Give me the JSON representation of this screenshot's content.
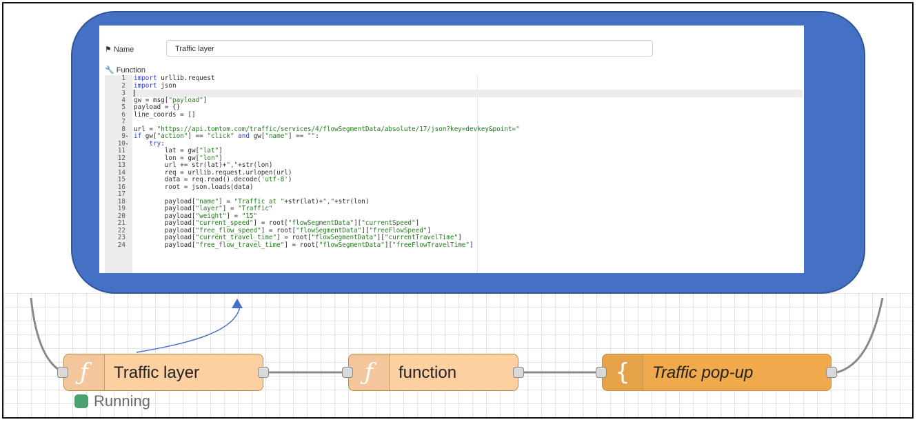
{
  "editor_panel": {
    "name_label": "Name",
    "name_value": "Traffic layer",
    "function_label": "Function",
    "code_lines": [
      {
        "n": "1",
        "fold": "",
        "active": false,
        "tokens": [
          {
            "t": "import",
            "c": "kw"
          },
          {
            "t": " urllib.request",
            "c": ""
          }
        ]
      },
      {
        "n": "2",
        "fold": "",
        "active": false,
        "tokens": [
          {
            "t": "import",
            "c": "kw"
          },
          {
            "t": " json",
            "c": ""
          }
        ]
      },
      {
        "n": "3",
        "fold": "",
        "active": true,
        "tokens": [],
        "cursor": true
      },
      {
        "n": "4",
        "fold": "",
        "active": false,
        "tokens": [
          {
            "t": "gw = msg[",
            "c": ""
          },
          {
            "t": "\"payload\"",
            "c": "str"
          },
          {
            "t": "]",
            "c": ""
          }
        ]
      },
      {
        "n": "5",
        "fold": "",
        "active": false,
        "tokens": [
          {
            "t": "payload = {}",
            "c": ""
          }
        ]
      },
      {
        "n": "6",
        "fold": "",
        "active": false,
        "tokens": [
          {
            "t": "line_coords = []",
            "c": ""
          }
        ]
      },
      {
        "n": "7",
        "fold": "",
        "active": false,
        "tokens": []
      },
      {
        "n": "8",
        "fold": "",
        "active": false,
        "tokens": [
          {
            "t": "url = ",
            "c": ""
          },
          {
            "t": "\"https://api.tomtom.com/traffic/services/4/flowSegmentData/absolute/17/json?key=devkey&point=\"",
            "c": "str"
          }
        ]
      },
      {
        "n": "9",
        "fold": "▾",
        "active": false,
        "tokens": [
          {
            "t": "if",
            "c": "kw"
          },
          {
            "t": " gw[",
            "c": ""
          },
          {
            "t": "\"action\"",
            "c": "str"
          },
          {
            "t": "] == ",
            "c": ""
          },
          {
            "t": "\"click\"",
            "c": "str"
          },
          {
            "t": " ",
            "c": ""
          },
          {
            "t": "and",
            "c": "kw"
          },
          {
            "t": " gw[",
            "c": ""
          },
          {
            "t": "\"name\"",
            "c": "str"
          },
          {
            "t": "] == ",
            "c": ""
          },
          {
            "t": "\"\"",
            "c": "str"
          },
          {
            "t": ":",
            "c": ""
          }
        ]
      },
      {
        "n": "10",
        "fold": "▾",
        "active": false,
        "tokens": [
          {
            "t": "    ",
            "c": ""
          },
          {
            "t": "try",
            "c": "kw"
          },
          {
            "t": ":",
            "c": ""
          }
        ]
      },
      {
        "n": "11",
        "fold": "",
        "active": false,
        "tokens": [
          {
            "t": "        lat = gw[",
            "c": ""
          },
          {
            "t": "\"lat\"",
            "c": "str"
          },
          {
            "t": "]",
            "c": ""
          }
        ]
      },
      {
        "n": "12",
        "fold": "",
        "active": false,
        "tokens": [
          {
            "t": "        lon = gw[",
            "c": ""
          },
          {
            "t": "\"lon\"",
            "c": "str"
          },
          {
            "t": "]",
            "c": ""
          }
        ]
      },
      {
        "n": "13",
        "fold": "",
        "active": false,
        "tokens": [
          {
            "t": "        url += str(lat)+",
            "c": ""
          },
          {
            "t": "\",\"",
            "c": "str"
          },
          {
            "t": "+str(lon)",
            "c": ""
          }
        ]
      },
      {
        "n": "14",
        "fold": "",
        "active": false,
        "tokens": [
          {
            "t": "        req = urllib.request.urlopen(url)",
            "c": ""
          }
        ]
      },
      {
        "n": "15",
        "fold": "",
        "active": false,
        "tokens": [
          {
            "t": "        data = req.read().decode(",
            "c": ""
          },
          {
            "t": "'utf-8'",
            "c": "str"
          },
          {
            "t": ")",
            "c": ""
          }
        ]
      },
      {
        "n": "16",
        "fold": "",
        "active": false,
        "tokens": [
          {
            "t": "        root = json.loads(data)",
            "c": ""
          }
        ]
      },
      {
        "n": "17",
        "fold": "",
        "active": false,
        "tokens": []
      },
      {
        "n": "18",
        "fold": "",
        "active": false,
        "tokens": [
          {
            "t": "        payload[",
            "c": ""
          },
          {
            "t": "\"name\"",
            "c": "str"
          },
          {
            "t": "] = ",
            "c": ""
          },
          {
            "t": "\"Traffic at \"",
            "c": "str"
          },
          {
            "t": "+str(lat)+",
            "c": ""
          },
          {
            "t": "\",\"",
            "c": "str"
          },
          {
            "t": "+str(lon)",
            "c": ""
          }
        ]
      },
      {
        "n": "19",
        "fold": "",
        "active": false,
        "tokens": [
          {
            "t": "        payload[",
            "c": ""
          },
          {
            "t": "\"layer\"",
            "c": "str"
          },
          {
            "t": "] = ",
            "c": ""
          },
          {
            "t": "\"Traffic\"",
            "c": "str"
          }
        ]
      },
      {
        "n": "20",
        "fold": "",
        "active": false,
        "tokens": [
          {
            "t": "        payload[",
            "c": ""
          },
          {
            "t": "\"weight\"",
            "c": "str"
          },
          {
            "t": "] = ",
            "c": ""
          },
          {
            "t": "\"15\"",
            "c": "str"
          }
        ]
      },
      {
        "n": "21",
        "fold": "",
        "active": false,
        "tokens": [
          {
            "t": "        payload[",
            "c": ""
          },
          {
            "t": "\"current_speed\"",
            "c": "str"
          },
          {
            "t": "] = root[",
            "c": ""
          },
          {
            "t": "\"flowSegmentData\"",
            "c": "str"
          },
          {
            "t": "][",
            "c": ""
          },
          {
            "t": "\"currentSpeed\"",
            "c": "str"
          },
          {
            "t": "]",
            "c": ""
          }
        ]
      },
      {
        "n": "22",
        "fold": "",
        "active": false,
        "tokens": [
          {
            "t": "        payload[",
            "c": ""
          },
          {
            "t": "\"free_flow_speed\"",
            "c": "str"
          },
          {
            "t": "] = root[",
            "c": ""
          },
          {
            "t": "\"flowSegmentData\"",
            "c": "str"
          },
          {
            "t": "][",
            "c": ""
          },
          {
            "t": "\"freeFlowSpeed\"",
            "c": "str"
          },
          {
            "t": "]",
            "c": ""
          }
        ]
      },
      {
        "n": "23",
        "fold": "",
        "active": false,
        "tokens": [
          {
            "t": "        payload[",
            "c": ""
          },
          {
            "t": "\"current_travel_time\"",
            "c": "str"
          },
          {
            "t": "] = root[",
            "c": ""
          },
          {
            "t": "\"flowSegmentData\"",
            "c": "str"
          },
          {
            "t": "][",
            "c": ""
          },
          {
            "t": "\"currentTravelTime\"",
            "c": "str"
          },
          {
            "t": "]",
            "c": ""
          }
        ]
      },
      {
        "n": "24",
        "fold": "",
        "active": false,
        "tokens": [
          {
            "t": "        payload[",
            "c": ""
          },
          {
            "t": "\"free_flow_travel_time\"",
            "c": "str"
          },
          {
            "t": "] = root[",
            "c": ""
          },
          {
            "t": "\"flowSegmentData\"",
            "c": "str"
          },
          {
            "t": "][",
            "c": ""
          },
          {
            "t": "\"freeFlowTravelTime\"",
            "c": "str"
          },
          {
            "t": "]",
            "c": ""
          }
        ]
      }
    ]
  },
  "flow": {
    "nodes": [
      {
        "id": "traffic-layer",
        "icon": "ƒ",
        "icon_name": "function-icon",
        "label": "Traffic layer",
        "color": "#fdd0a2",
        "italic": false
      },
      {
        "id": "function",
        "icon": "ƒ",
        "icon_name": "function-icon",
        "label": "function",
        "color": "#fdd0a2",
        "italic": false
      },
      {
        "id": "traffic-popup",
        "icon": "{",
        "icon_name": "template-icon",
        "label": "Traffic pop-up",
        "color": "#f0a94b",
        "italic": true
      }
    ],
    "status": {
      "text": "Running",
      "color": "#4aa36e"
    }
  },
  "colors": {
    "callout": "#4471c4",
    "keyword": "#2b3fd6",
    "string": "#1f7c1a",
    "wire": "#888888"
  }
}
